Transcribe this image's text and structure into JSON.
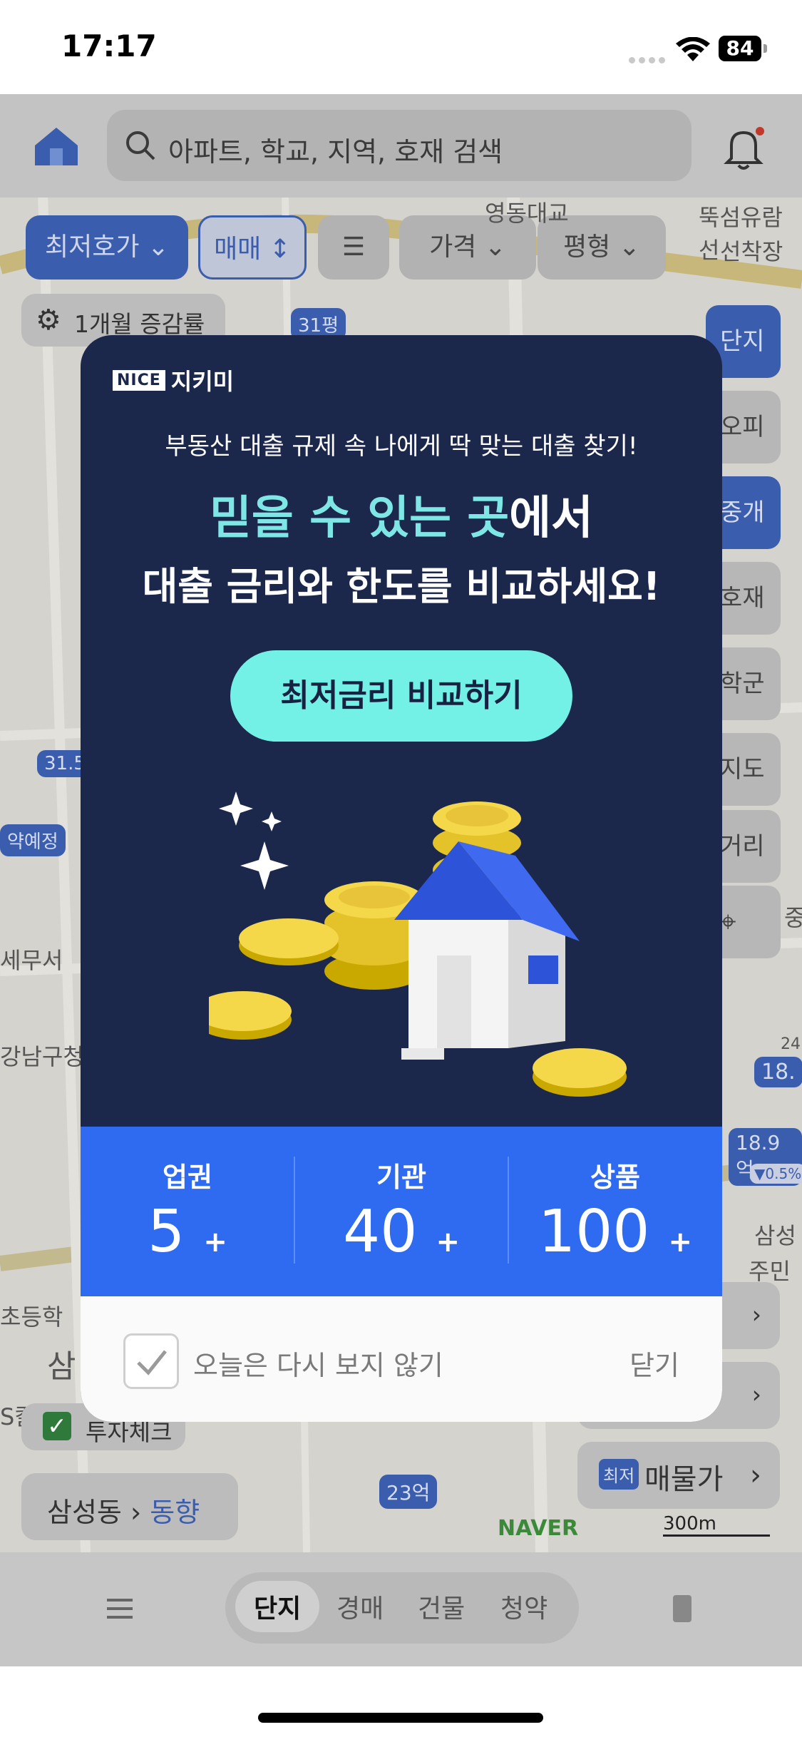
{
  "status": {
    "time": "17:17",
    "battery": "84"
  },
  "top": {
    "search_placeholder": "아파트, 학교, 지역, 호재 검색",
    "filters": [
      "최저호가",
      "매매",
      "가격",
      "평형"
    ],
    "change_rate": "1개월 증감률"
  },
  "map": {
    "labels": [
      "영동대교",
      "뚝섬유람선",
      "선착장",
      "31평",
      "31.5",
      "약예정",
      "세무서",
      "강남구청",
      "초등학",
      "삼",
      "S칼텍",
      "삼성",
      "주민",
      "중",
      "18.",
      "24"
    ],
    "markers": [
      "18.9억",
      "23억",
      "▼0.5%"
    ],
    "side_buttons": [
      "단지",
      "오피",
      "중개",
      "호재",
      "학군",
      "지도",
      "거리"
    ],
    "invest_check": "투자체크",
    "area_title": "삼성동",
    "area_link": "동향",
    "price_button_badge": "최저",
    "price_button_label": "매물가",
    "naver": "NAVER",
    "scale": "300m"
  },
  "bottom_nav": {
    "tabs": [
      "단지",
      "경매",
      "건물",
      "청약"
    ]
  },
  "modal": {
    "logo_badge": "NICE",
    "logo_text": "지키미",
    "subtitle": "부동산 대출 규제 속 나에게 딱 맞는 대출 찾기!",
    "headline_highlight": "믿을 수 있는 곳",
    "headline_rest": "에서",
    "headline2": "대출 금리와 한도를 비교하세요!",
    "cta": "최저금리 비교하기",
    "stats": [
      {
        "label": "업권",
        "value": "5",
        "suffix": "+"
      },
      {
        "label": "기관",
        "value": "40",
        "suffix": "+"
      },
      {
        "label": "상품",
        "value": "100",
        "suffix": "+"
      }
    ],
    "dont_show": "오늘은 다시 보지 않기",
    "close": "닫기"
  },
  "colors": {
    "modal_bg": "#1c274c",
    "cta": "#73f1e6",
    "stats_bar": "#2e6bf1",
    "highlight": "#7fe6e6"
  }
}
